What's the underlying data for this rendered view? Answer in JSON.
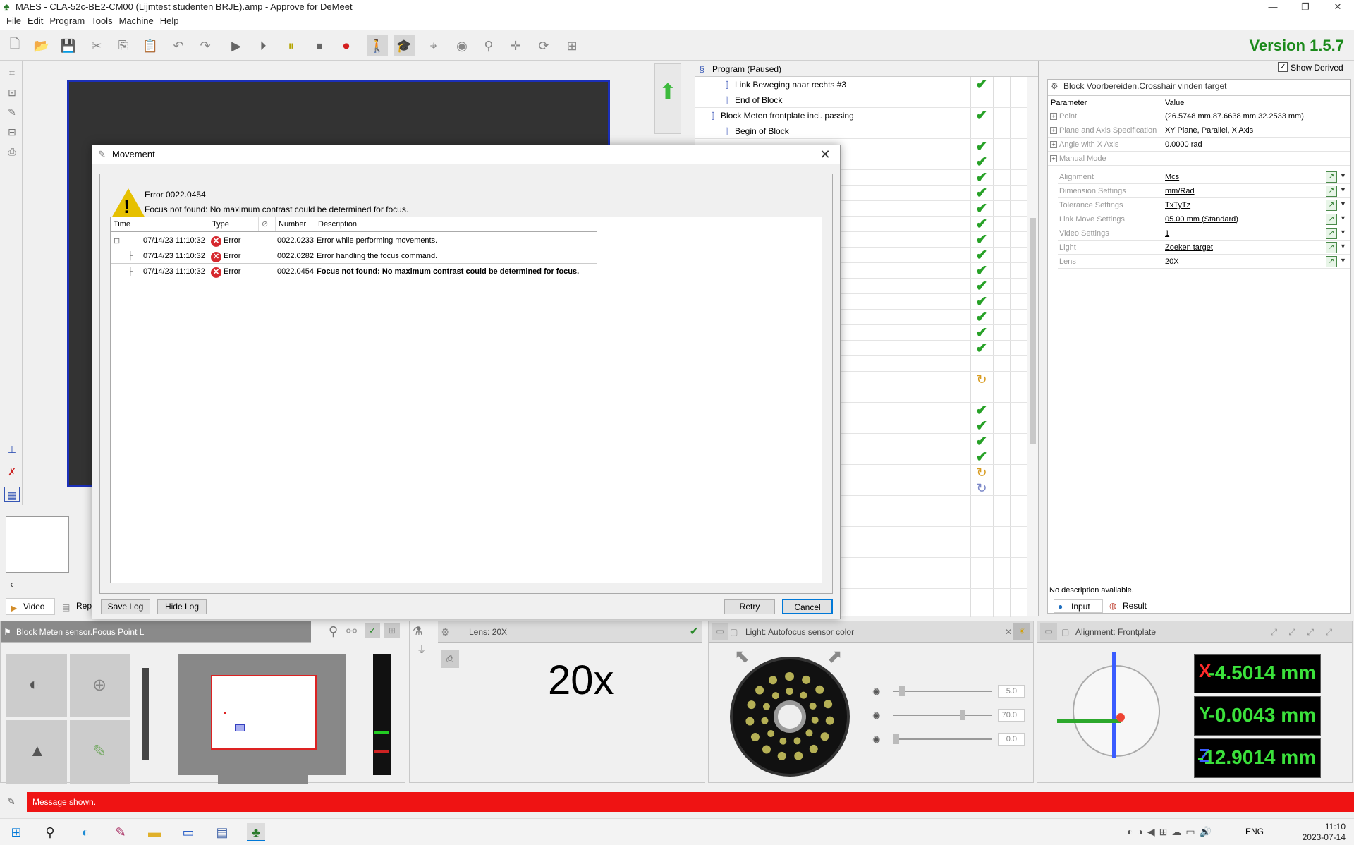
{
  "window": {
    "title": "MAES - CLA-52c-BE2-CM00 (Lijmtest studenten BRJE).amp - Approve for DeMeet"
  },
  "menu": [
    "File",
    "Edit",
    "Program",
    "Tools",
    "Machine",
    "Help"
  ],
  "version": "Version 1.5.7",
  "tree": {
    "header": "Program (Paused)",
    "show_derived": "Show Derived",
    "rows": [
      {
        "label": "Link Beweging naar rechts #3",
        "status": "ok"
      },
      {
        "label": "End of Block",
        "status": ""
      },
      {
        "label": "Block Meten frontplate incl. passing",
        "status": "ok"
      },
      {
        "label": "Begin of Block",
        "status": ""
      }
    ],
    "status_column": [
      "ok",
      "ok",
      "ok",
      "ok",
      "ok",
      "ok",
      "ok",
      "ok",
      "ok",
      "ok",
      "ok",
      "ok",
      "ok",
      "ok",
      "",
      "refresh",
      "",
      "ok",
      "ok",
      "ok",
      "ok",
      "refresh",
      "refresh-blue"
    ]
  },
  "params": {
    "title": "Block Voorbereiden.Crosshair vinden target",
    "col_param": "Parameter",
    "col_value": "Value",
    "rows": [
      {
        "name": "Point",
        "value": "(26.5748 mm,87.6638 mm,32.2533 mm)"
      },
      {
        "name": "Plane and Axis Specification",
        "value": "XY Plane, Parallel, X Axis"
      },
      {
        "name": "Angle with X Axis",
        "value": "0.0000 rad"
      },
      {
        "name": "Manual Mode",
        "value": ""
      }
    ],
    "settings": [
      {
        "name": "Alignment",
        "value": "Mcs"
      },
      {
        "name": "Dimension Settings",
        "value": "mm/Rad"
      },
      {
        "name": "Tolerance Settings",
        "value": "TxTyTz"
      },
      {
        "name": "Link Move Settings",
        "value": "05.00 mm (Standard)"
      },
      {
        "name": "Video Settings",
        "value": "1"
      },
      {
        "name": "Light",
        "value": "Zoeken target"
      },
      {
        "name": "Lens",
        "value": "20X"
      }
    ],
    "description": "No description available.",
    "tab_input": "Input",
    "tab_result": "Result"
  },
  "left_tabs": {
    "video": "Video",
    "rep": "Rep"
  },
  "bottom": {
    "focus_title": "Block Meten sensor.Focus Point L",
    "lens_title": "Lens: 20X",
    "lens_big": "20x",
    "light_title": "Light: Autofocus sensor color",
    "light_values": [
      "5.0",
      "70.0",
      "0.0"
    ],
    "alignment_title": "Alignment: Frontplate",
    "coords": [
      {
        "axis": "X",
        "value": "-4.5014 mm",
        "color": "#ff2a2a"
      },
      {
        "axis": "Y",
        "value": "-0.0043 mm",
        "color": "#3be13b"
      },
      {
        "axis": "Z",
        "value": "-12.9014 mm",
        "color": "#3a5cff"
      }
    ]
  },
  "message_bar": "Message shown.",
  "dialog": {
    "title": "Movement",
    "error_code": "Error 0022.0454",
    "error_message": "Focus not found: No maximum contrast could be determined for focus.",
    "columns": {
      "time": "Time",
      "type": "Type",
      "number": "Number",
      "description": "Description"
    },
    "log": [
      {
        "time": "07/14/23 11:10:32",
        "type": "Error",
        "number": "0022.0233",
        "description": "Error while performing movements."
      },
      {
        "time": "07/14/23 11:10:32",
        "type": "Error",
        "number": "0022.0282",
        "description": "Error handling the focus command."
      },
      {
        "time": "07/14/23 11:10:32",
        "type": "Error",
        "number": "0022.0454",
        "description": "Focus not found: No maximum contrast could be determined for focus."
      }
    ],
    "save_log": "Save Log",
    "hide_log": "Hide Log",
    "retry": "Retry",
    "cancel": "Cancel"
  },
  "taskbar": {
    "lang": "ENG",
    "time": "11:10",
    "date": "2023-07-14"
  }
}
